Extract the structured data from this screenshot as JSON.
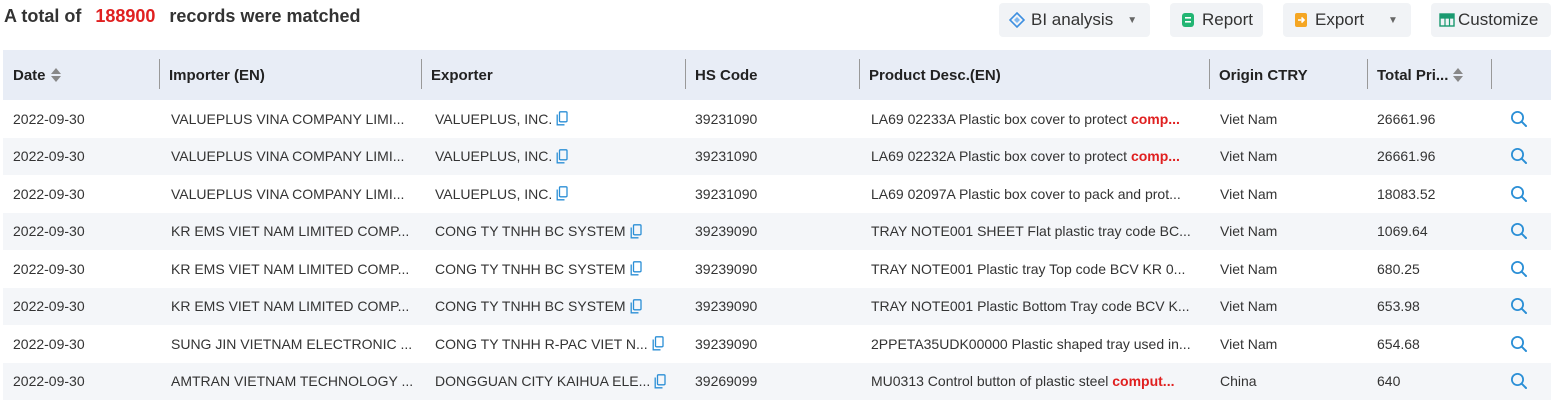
{
  "summary": {
    "prefix": "A total of",
    "count": "188900",
    "suffix": "records were matched"
  },
  "toolbar": {
    "bi_label": "BI analysis",
    "report_label": "Report",
    "export_label": "Export",
    "customize_label": "Customize"
  },
  "columns": {
    "date": "Date",
    "importer": "Importer (EN)",
    "exporter": "Exporter",
    "hs_code": "HS Code",
    "product": "Product Desc.(EN)",
    "origin": "Origin CTRY",
    "total": "Total Pri..."
  },
  "rows": [
    {
      "date": "2022-09-30",
      "importer": "VALUEPLUS VINA COMPANY LIMI...",
      "exporter": "VALUEPLUS, INC.",
      "hs": "39231090",
      "prod_pre": "LA69 02233A Plastic box cover to protect ",
      "prod_hl": "comp...",
      "origin": "Viet Nam",
      "total": "26661.96"
    },
    {
      "date": "2022-09-30",
      "importer": "VALUEPLUS VINA COMPANY LIMI...",
      "exporter": "VALUEPLUS, INC.",
      "hs": "39231090",
      "prod_pre": "LA69 02232A Plastic box cover to protect ",
      "prod_hl": "comp...",
      "origin": "Viet Nam",
      "total": "26661.96"
    },
    {
      "date": "2022-09-30",
      "importer": "VALUEPLUS VINA COMPANY LIMI...",
      "exporter": "VALUEPLUS, INC.",
      "hs": "39231090",
      "prod_pre": "LA69 02097A Plastic box cover to pack and prot...",
      "prod_hl": "",
      "origin": "Viet Nam",
      "total": "18083.52"
    },
    {
      "date": "2022-09-30",
      "importer": "KR EMS VIET NAM LIMITED COMP...",
      "exporter": "CONG TY TNHH BC SYSTEM",
      "hs": "39239090",
      "prod_pre": "TRAY NOTE001 SHEET Flat plastic tray code BC...",
      "prod_hl": "",
      "origin": "Viet Nam",
      "total": "1069.64"
    },
    {
      "date": "2022-09-30",
      "importer": "KR EMS VIET NAM LIMITED COMP...",
      "exporter": "CONG TY TNHH BC SYSTEM",
      "hs": "39239090",
      "prod_pre": "TRAY NOTE001 Plastic tray Top code BCV KR 0...",
      "prod_hl": "",
      "origin": "Viet Nam",
      "total": "680.25"
    },
    {
      "date": "2022-09-30",
      "importer": "KR EMS VIET NAM LIMITED COMP...",
      "exporter": "CONG TY TNHH BC SYSTEM",
      "hs": "39239090",
      "prod_pre": "TRAY NOTE001 Plastic Bottom Tray code BCV K...",
      "prod_hl": "",
      "origin": "Viet Nam",
      "total": "653.98"
    },
    {
      "date": "2022-09-30",
      "importer": "SUNG JIN VIETNAM ELECTRONIC ...",
      "exporter": "CONG TY TNHH R-PAC VIET N...",
      "hs": "39239090",
      "prod_pre": "2PPETA35UDK00000 Plastic shaped tray used in...",
      "prod_hl": "",
      "origin": "Viet Nam",
      "total": "654.68"
    },
    {
      "date": "2022-09-30",
      "importer": "AMTRAN VIETNAM TECHNOLOGY ...",
      "exporter": "DONGGUAN CITY KAIHUA ELE...",
      "hs": "39269099",
      "prod_pre": "MU0313 Control button of plastic steel ",
      "prod_hl": "comput...",
      "origin": "China",
      "total": "640"
    }
  ],
  "icons": {
    "bi": "bi-analysis-icon",
    "report": "report-icon",
    "export": "export-icon",
    "customize": "customize-icon",
    "copy": "copy-icon",
    "search": "search-icon",
    "sort": "sort-icon"
  },
  "colors": {
    "accent_red": "#e02020",
    "header_bg": "#e8edf6",
    "row_alt": "#f4f6f9",
    "icon_blue": "#2b8fd6",
    "button_bg": "#f1f3f6"
  }
}
